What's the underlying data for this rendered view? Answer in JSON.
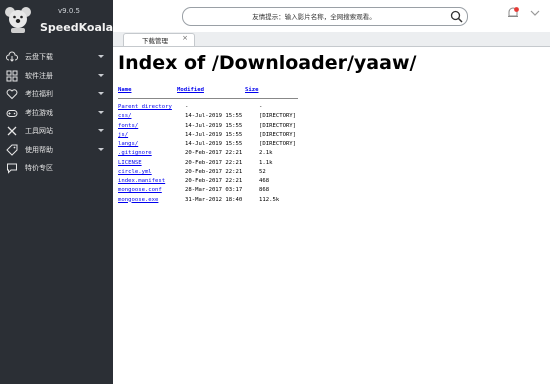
{
  "app": {
    "name": "SpeedKoala",
    "version": "v9.0.5"
  },
  "sidebar": {
    "items": [
      {
        "label": "云盘下载",
        "icon": "cloud-download-icon",
        "has_arrow": true
      },
      {
        "label": "软件注册",
        "icon": "grid-icon",
        "has_arrow": true
      },
      {
        "label": "考拉福利",
        "icon": "heart-icon",
        "has_arrow": true
      },
      {
        "label": "考拉游戏",
        "icon": "gamepad-icon",
        "has_arrow": true
      },
      {
        "label": "工具网站",
        "icon": "tools-icon",
        "has_arrow": true
      },
      {
        "label": "使用帮助",
        "icon": "tag-icon",
        "has_arrow": true
      },
      {
        "label": "特价专区",
        "icon": "chat-icon",
        "has_arrow": false
      }
    ]
  },
  "search": {
    "text": "友情提示：输入影片名称，全网搜索观看。"
  },
  "tab": {
    "label": "下载管理",
    "close": "×"
  },
  "page": {
    "title": "Index of /Downloader/yaaw/"
  },
  "listing": {
    "headers": {
      "name": "Name",
      "modified": "Modified",
      "size": "Size"
    },
    "rows": [
      {
        "name": "Parent directory",
        "modified": "-",
        "size": "-"
      },
      {
        "name": "css/",
        "modified": "14-Jul-2019 15:55",
        "size": "[DIRECTORY]"
      },
      {
        "name": "fonts/",
        "modified": "14-Jul-2019 15:55",
        "size": "[DIRECTORY]"
      },
      {
        "name": "js/",
        "modified": "14-Jul-2019 15:55",
        "size": "[DIRECTORY]"
      },
      {
        "name": "langs/",
        "modified": "14-Jul-2019 15:55",
        "size": "[DIRECTORY]"
      },
      {
        "name": ".gitignore",
        "modified": "20-Feb-2017 22:21",
        "size": "2.1k"
      },
      {
        "name": "LICENSE",
        "modified": "20-Feb-2017 22:21",
        "size": "1.1k"
      },
      {
        "name": "circle.yml",
        "modified": "20-Feb-2017 22:21",
        "size": "52"
      },
      {
        "name": "index.manifest",
        "modified": "20-Feb-2017 22:21",
        "size": "468"
      },
      {
        "name": "mongoose.conf",
        "modified": "28-Mar-2017 03:17",
        "size": "868"
      },
      {
        "name": "mongoose.exe",
        "modified": "31-Mar-2012 18:40",
        "size": "112.5k"
      }
    ]
  },
  "colors": {
    "sidebar_bg": "#2b2f35",
    "link": "#0000ee",
    "notify_badge": "#e53935"
  }
}
